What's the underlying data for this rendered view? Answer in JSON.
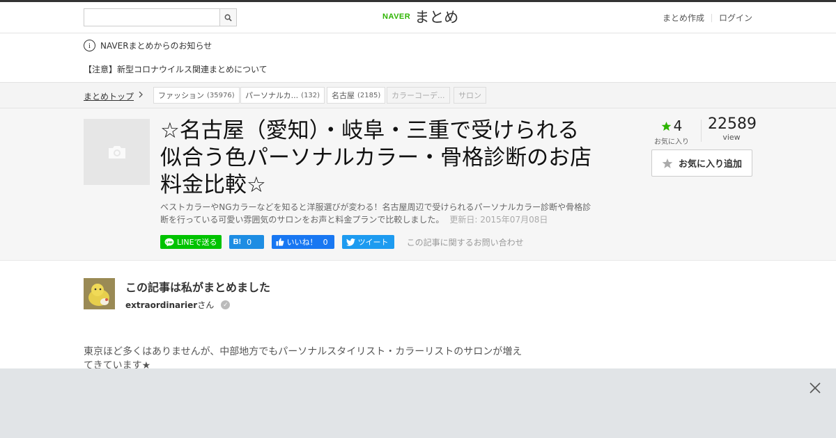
{
  "header": {
    "search": {
      "value": "",
      "placeholder": ""
    },
    "logo_naver": "NAVER",
    "logo_matome": "まとめ",
    "nav": {
      "create": "まとめ作成",
      "login": "ログイン"
    }
  },
  "notices": {
    "title": "NAVERまとめからのお知らせ",
    "item": "【注意】新型コロナウイルス関連まとめについて"
  },
  "breadcrumb": {
    "top": "まとめトップ",
    "tags": [
      {
        "label": "ファッション",
        "count": "(35976)"
      },
      {
        "label": "パーソナルカ...",
        "count": "(132)"
      },
      {
        "label": "名古屋",
        "count": "(2185)"
      },
      {
        "label": "カラーコーデ...",
        "count": ""
      },
      {
        "label": "サロン",
        "count": ""
      }
    ]
  },
  "article": {
    "title": "☆名古屋（愛知）・岐阜・三重で受けられる似合う色パーソナルカラー・骨格診断のお店料金比較☆",
    "description": "ベストカラーやNGカラーなどを知ると洋服選びが変わる！名古屋周辺で受けられるパーソナルカラー診断や骨格診断を行っている可愛い雰囲気のサロンをお声と料金プランで比較しました。",
    "updated": "更新日: 2015年07月08日",
    "favorites": "4",
    "favorites_label": "お気に入り",
    "views": "22589",
    "views_label": "view",
    "fav_button": "お気に入り追加"
  },
  "share": {
    "line": "LINEで送る",
    "hatena_icon": "B!",
    "hatena_count": "0",
    "fb_label": "いいね！",
    "fb_count": "0",
    "tweet": "ツイート",
    "inquiry": "この記事に関するお問い合わせ"
  },
  "author": {
    "heading": "この記事は私がまとめました",
    "name": "extraordinarier",
    "suffix": "さん"
  },
  "body": {
    "text": "東京ほど多くはありませんが、中部地方でもパーソナルスタイリスト・カラーリストのサロンが増えてきています★"
  },
  "colors": {
    "naver_green": "#2db400",
    "line_green": "#00c300",
    "hatena_blue": "#1d8de3",
    "facebook_blue": "#1877f2",
    "twitter_blue": "#1d9bf0",
    "star_green": "#2db400"
  }
}
